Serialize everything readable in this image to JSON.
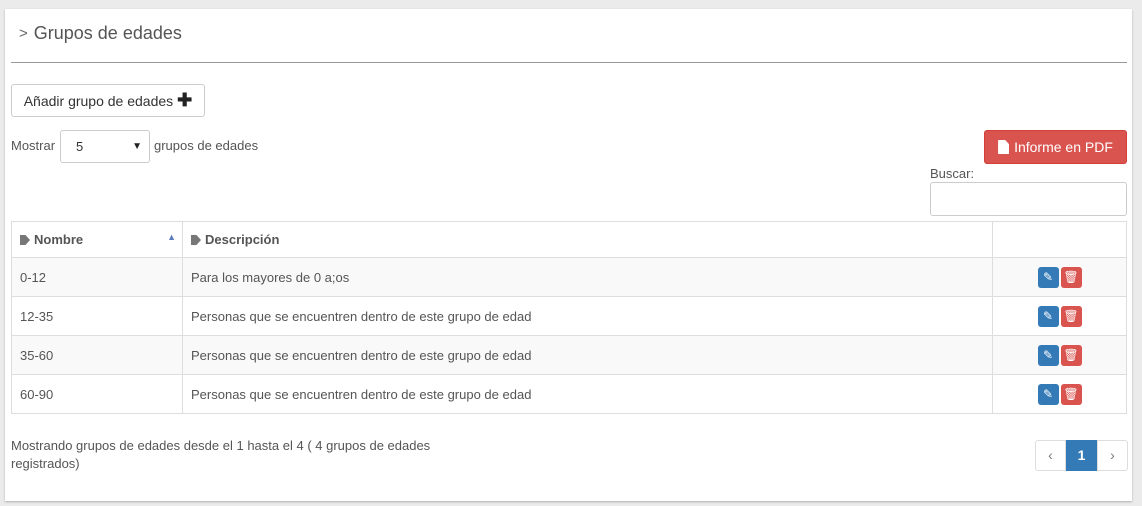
{
  "page": {
    "title": "Grupos de edades"
  },
  "toolbar": {
    "add_label": "Añadir grupo de edades",
    "pdf_label": "Informe en PDF"
  },
  "length": {
    "prefix": "Mostrar",
    "value": "5",
    "suffix": "grupos de edades"
  },
  "search": {
    "label": "Buscar:",
    "value": "",
    "placeholder": ""
  },
  "table": {
    "columns": [
      "Nombre",
      "Descripción",
      ""
    ],
    "rows": [
      {
        "nombre": "0-12",
        "descripcion": "Para los mayores de 0 a;os"
      },
      {
        "nombre": "12-35",
        "descripcion": "Personas que se encuentren dentro de este grupo de edad"
      },
      {
        "nombre": "35-60",
        "descripcion": "Personas que se encuentren dentro de este grupo de edad"
      },
      {
        "nombre": "60-90",
        "descripcion": "Personas que se encuentren dentro de este grupo de edad"
      }
    ]
  },
  "footer": {
    "info": "Mostrando grupos de edades desde el 1 hasta el 4 ( 4 grupos de edades registrados)",
    "pagination": {
      "prev": "‹",
      "current": "1",
      "next": "›"
    }
  },
  "colors": {
    "primary": "#337ab7",
    "danger": "#d9534f"
  },
  "icons": {
    "add": "plus-icon",
    "pdf": "file-icon",
    "column": "tag-icon",
    "edit": "pencil-icon",
    "delete": "trash-icon"
  }
}
